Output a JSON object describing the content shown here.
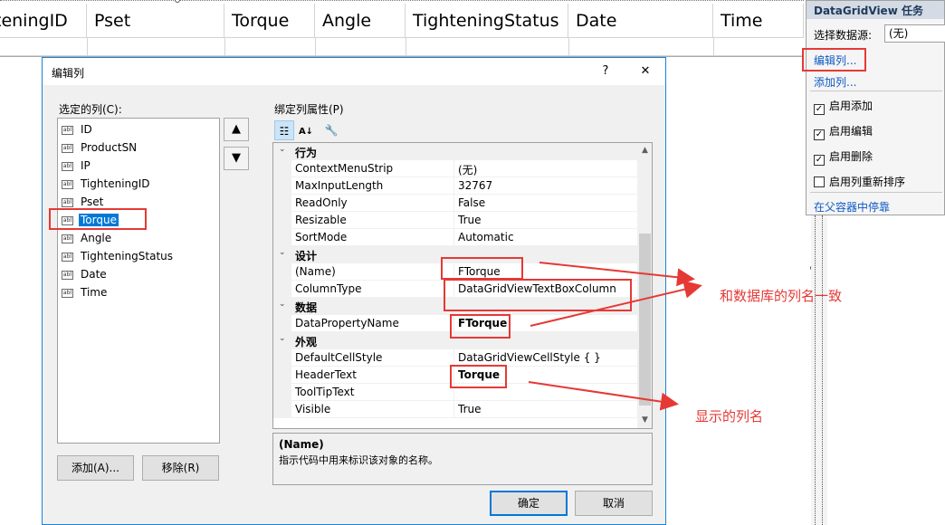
{
  "grid": {
    "columns": [
      "teningID",
      "Pset",
      "Torque",
      "Angle",
      "TighteningStatus",
      "Date",
      "Time"
    ]
  },
  "dialog": {
    "title": "编辑列",
    "help": "?",
    "close": "✕",
    "selected_columns_label": "选定的列(C):",
    "bound_props_label": "绑定列属性(P)",
    "columns": [
      "ID",
      "ProductSN",
      "IP",
      "TighteningID",
      "Pset",
      "Torque",
      "Angle",
      "TighteningStatus",
      "Date",
      "Time"
    ],
    "selected_index": 5,
    "move_up": "🡅",
    "move_down": "🡇",
    "add_button": "添加(A)...",
    "remove_button": "移除(R)",
    "ok_button": "确定",
    "cancel_button": "取消",
    "properties": [
      {
        "category": "行为"
      },
      {
        "name": "ContextMenuStrip",
        "value": "(无)"
      },
      {
        "name": "MaxInputLength",
        "value": "32767"
      },
      {
        "name": "ReadOnly",
        "value": "False"
      },
      {
        "name": "Resizable",
        "value": "True"
      },
      {
        "name": "SortMode",
        "value": "Automatic"
      },
      {
        "category": "设计"
      },
      {
        "name": "(Name)",
        "value": "FTorque"
      },
      {
        "name": "ColumnType",
        "value": "DataGridViewTextBoxColumn"
      },
      {
        "category": "数据"
      },
      {
        "name": "DataPropertyName",
        "value": "FTorque",
        "bold": true
      },
      {
        "category": "外观"
      },
      {
        "name": "DefaultCellStyle",
        "value": "DataGridViewCellStyle { }"
      },
      {
        "name": "HeaderText",
        "value": "Torque",
        "bold": true
      },
      {
        "name": "ToolTipText",
        "value": ""
      },
      {
        "name": "Visible",
        "value": "True"
      }
    ],
    "description_title": "(Name)",
    "description_text": "指示代码中用来标识该对象的名称。"
  },
  "tasks": {
    "title": "DataGridView 任务",
    "datasource_label": "选择数据源:",
    "datasource_value": "(无)",
    "edit_columns": "编辑列...",
    "add_column": "添加列...",
    "enable_add": "启用添加",
    "enable_edit": "启用编辑",
    "enable_delete": "启用删除",
    "enable_reorder": "启用列重新排序",
    "dock": "在父容器中停靠",
    "checked": [
      true,
      true,
      true,
      false
    ]
  },
  "annotations": {
    "match_db": "和数据库的列名一致",
    "display_name": "显示的列名"
  },
  "colors": {
    "accent": "#0078d7",
    "annotation": "#e53935",
    "link": "#0e59c4"
  }
}
